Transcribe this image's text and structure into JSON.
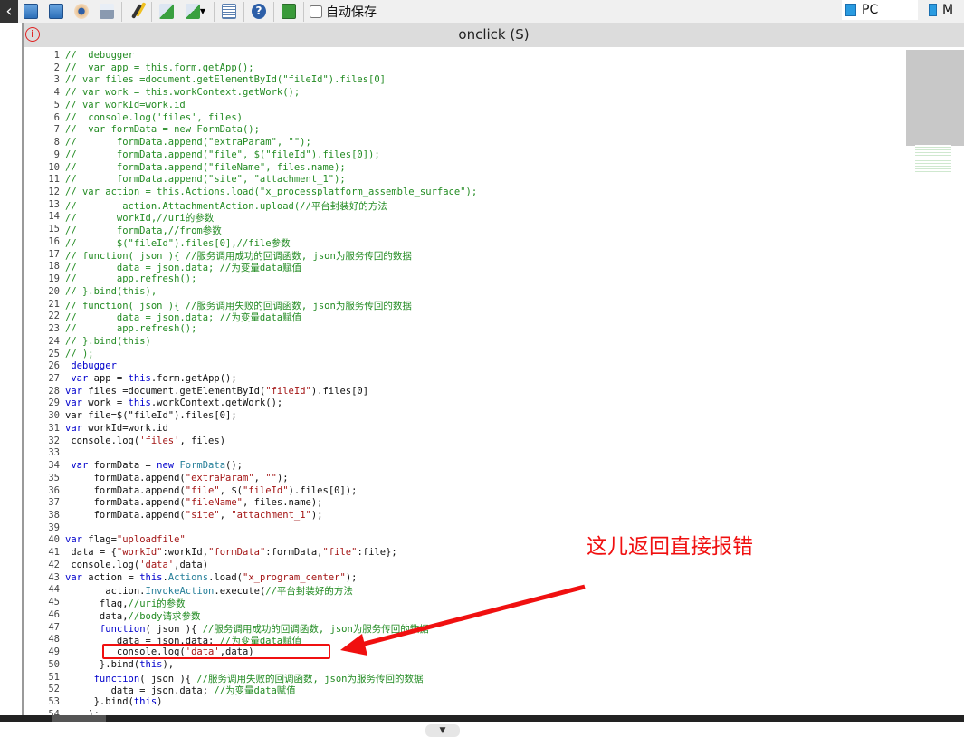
{
  "toolbar": {
    "icons": [
      "save-icon",
      "save-as-icon",
      "preview-icon",
      "print-icon",
      "wand-icon",
      "import-icon",
      "export-icon",
      "list-icon",
      "help-icon",
      "layer-icon"
    ],
    "autosave_label": "自动保存",
    "autosave_checked": false,
    "device_pc": "PC",
    "device_mobile": "M"
  },
  "header": {
    "title": "onclick (S)",
    "info_glyph": "i"
  },
  "code": {
    "lines": [
      "//  debugger",
      "//  var app = this.form.getApp();",
      "// var files =document.getElementById(\"fileId\").files[0]",
      "// var work = this.workContext.getWork();",
      "// var workId=work.id",
      "//  console.log('files', files)",
      "//  var formData = new FormData();",
      "//       formData.append(\"extraParam\", \"\");",
      "//       formData.append(\"file\", $(\"fileId\").files[0]);",
      "//       formData.append(\"fileName\", files.name);",
      "//       formData.append(\"site\", \"attachment_1\");",
      "// var action = this.Actions.load(\"x_processplatform_assemble_surface\");",
      "//        action.AttachmentAction.upload(//平台封装好的方法",
      "//       workId,//uri的参数",
      "//       formData,//from参数",
      "//       $(\"fileId\").files[0],//file参数",
      "// function( json ){ //服务调用成功的回调函数, json为服务传回的数据",
      "//       data = json.data; //为变量data赋值",
      "//       app.refresh();",
      "// }.bind(this),",
      "// function( json ){ //服务调用失败的回调函数, json为服务传回的数据",
      "//       data = json.data; //为变量data赋值",
      "//       app.refresh();",
      "// }.bind(this)",
      "// );",
      " debugger",
      " var app = this.form.getApp();",
      "var files =document.getElementById(\"fileId\").files[0]",
      "var work = this.workContext.getWork();",
      "var file=$(\"fileId\").files[0];",
      "var workId=work.id",
      " console.log('files', files)",
      "",
      " var formData = new FormData();",
      "     formData.append(\"extraParam\", \"\");",
      "     formData.append(\"file\", $(\"fileId\").files[0]);",
      "     formData.append(\"fileName\", files.name);",
      "     formData.append(\"site\", \"attachment_1\");",
      "",
      "var flag=\"uploadfile\"",
      " data = {\"workId\":workId,\"formData\":formData,\"file\":file};",
      " console.log('data',data)",
      "var action = this.Actions.load(\"x_program_center\");",
      "       action.InvokeAction.execute(//平台封装好的方法",
      "      flag,//uri的参数",
      "      data,//body请求参数",
      "      function( json ){ //服务调用成功的回调函数, json为服务传回的数据",
      "         data = json.data; //为变量data赋值",
      "         console.log('data',data)",
      "      }.bind(this),",
      "     function( json ){ //服务调用失败的回调函数, json为服务传回的数据",
      "        data = json.data; //为变量data赋值",
      "     }.bind(this)",
      "    );"
    ]
  },
  "annotation": {
    "text": "这儿返回直接报错",
    "color": "#f01010"
  }
}
